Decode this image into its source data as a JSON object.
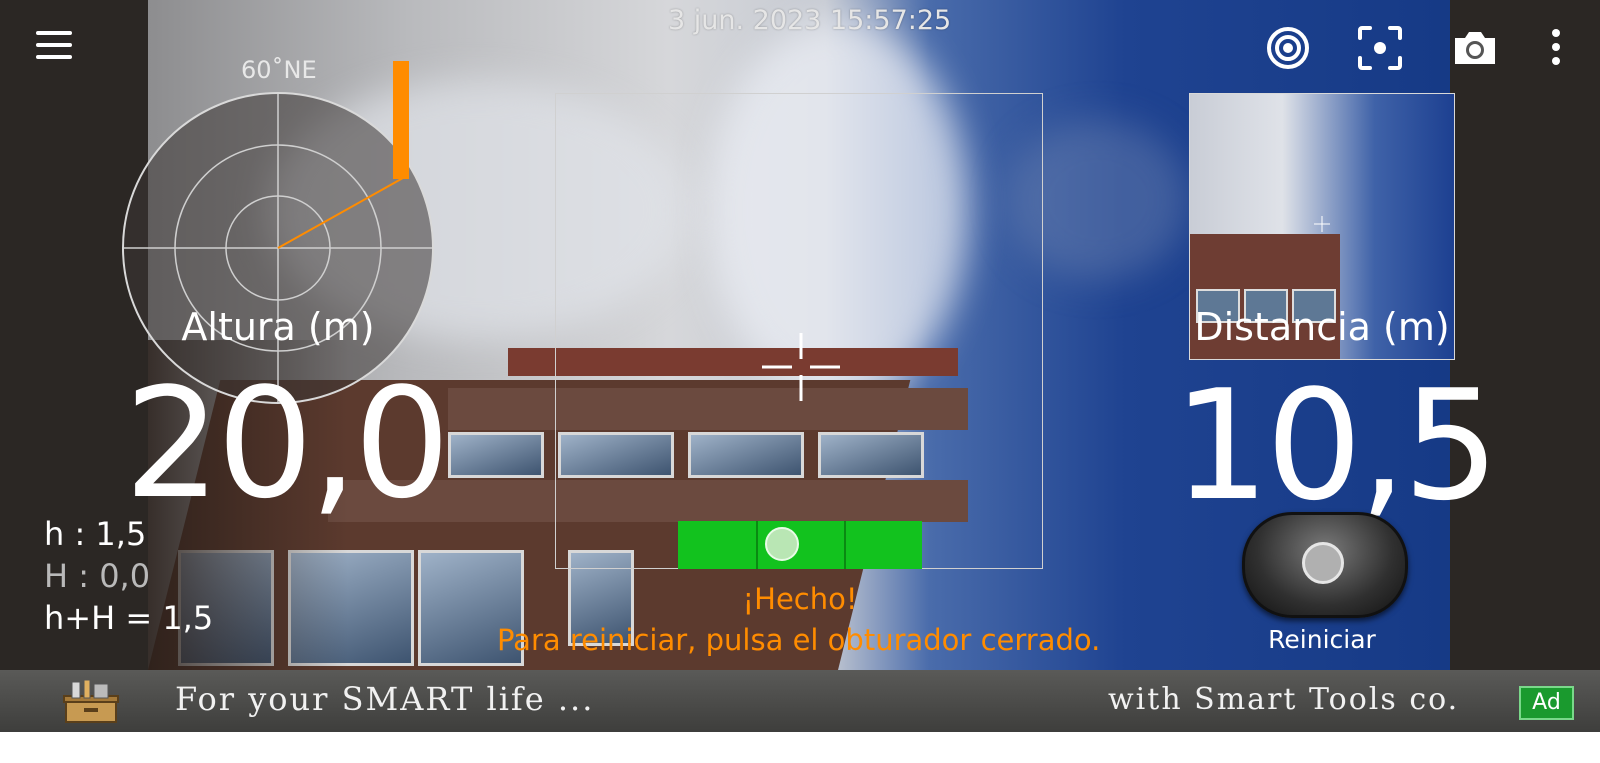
{
  "header": {
    "datetime": "3 jun. 2023 15:57:25"
  },
  "toolbar": {
    "icons": [
      "menu-icon",
      "target-icon",
      "focus-icon",
      "camera-icon",
      "more-vert-icon"
    ]
  },
  "compass": {
    "direction": "60˚NE"
  },
  "height": {
    "label": "Altura (m)",
    "value": "20,0"
  },
  "distance": {
    "label": "Distancia (m)",
    "value": "10,5"
  },
  "params": {
    "h": "h : 1,5",
    "H": "H : 0,0",
    "sum": "h+H = 1,5"
  },
  "status": {
    "done": "¡Hecho!",
    "hint": "Para reiniciar, pulsa el obturador cerrado."
  },
  "controls": {
    "reset_label": "Reiniciar"
  },
  "ad": {
    "left_text": "For your SMART life ...",
    "right_text": "with Smart Tools co.",
    "badge": "Ad"
  },
  "colors": {
    "accent": "#ff8c00",
    "level": "#12c21e",
    "ad_badge": "#1a9a2e"
  }
}
